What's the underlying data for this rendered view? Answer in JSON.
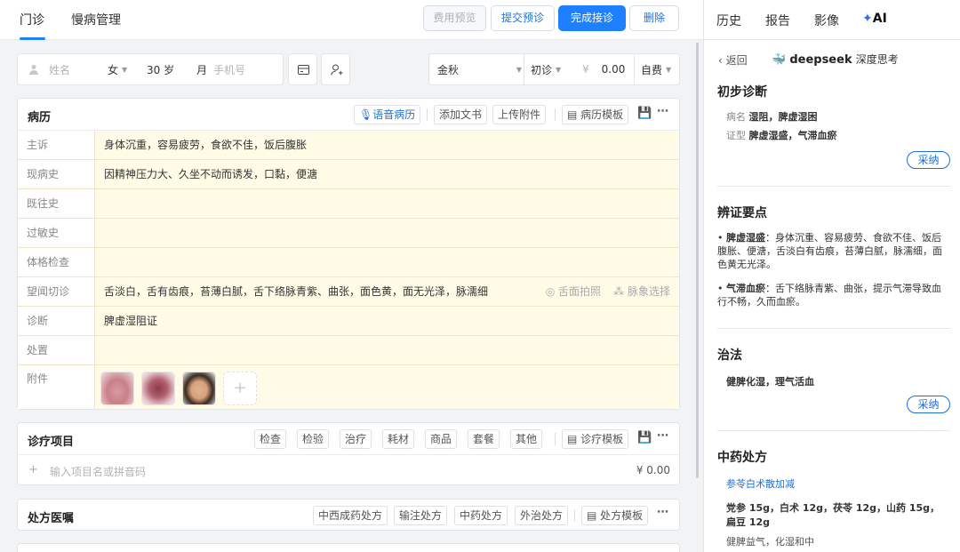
{
  "topbar": {
    "tabs": [
      "门诊",
      "慢病管理"
    ],
    "buttons": {
      "fee_preview": "费用预览",
      "submit_pre": "提交预诊",
      "complete": "完成接诊",
      "delete": "删除"
    }
  },
  "patient": {
    "name_placeholder": "姓名",
    "gender": "女",
    "age": "30 岁",
    "month": "月",
    "phone_placeholder": "手机号",
    "doctor": "金秋",
    "visit_type": "初诊",
    "currency": "¥",
    "fee": "0.00",
    "pay_type": "自费"
  },
  "record": {
    "title": "病历",
    "actions": {
      "voice": "语音病历",
      "add_text": "添加文书",
      "upload": "上传附件",
      "template": "病历模板"
    },
    "rows": [
      {
        "label": "主诉",
        "value": "身体沉重，容易疲劳，食欲不佳，饭后腹胀"
      },
      {
        "label": "现病史",
        "value": "因精神压力大、久坐不动而诱发，口黏，便溏"
      },
      {
        "label": "既往史",
        "value": ""
      },
      {
        "label": "过敏史",
        "value": ""
      },
      {
        "label": "体格检查",
        "value": ""
      },
      {
        "label": "望闻切诊",
        "value": "舌淡白，舌有齿痕，苔薄白腻，舌下络脉青紫、曲张，面色黄，面无光泽，脉濡细"
      },
      {
        "label": "诊断",
        "value": "脾虚湿阻证"
      },
      {
        "label": "处置",
        "value": ""
      },
      {
        "label": "附件",
        "value": ""
      }
    ],
    "tongue_photo": "舌面拍照",
    "pulse_select": "脉象选择"
  },
  "treatment": {
    "title": "诊疗项目",
    "chips": [
      "检查",
      "检验",
      "治疗",
      "耗材",
      "商品",
      "套餐",
      "其他"
    ],
    "template": "诊疗模板",
    "input_placeholder": "输入项目名或拼音码",
    "total": "¥ 0.00"
  },
  "prescription": {
    "title": "处方医嘱",
    "chips": [
      "中西成药处方",
      "输注处方",
      "中药处方",
      "外治处方"
    ],
    "template": "处方模板"
  },
  "right": {
    "tabs": [
      "历史",
      "报告",
      "影像",
      "AI"
    ],
    "back": "返回",
    "brand": "deepseek",
    "mode": "深度思考",
    "initial_dx": {
      "title": "初步诊断",
      "disease_label": "病名",
      "disease": "湿阻，脾虚湿困",
      "syndrome_label": "证型",
      "syndrome": "脾虚湿盛，气滞血瘀",
      "adopt": "采纳"
    },
    "key_points": {
      "title": "辨证要点",
      "items": [
        {
          "term": "脾虚湿盛",
          "text": "：身体沉重、容易疲劳、食欲不佳、饭后腹胀、便溏，舌淡白有齿痕，苔薄白腻，脉濡细，面色黄无光泽。"
        },
        {
          "term": "气滞血瘀",
          "text": "：舌下络脉青紫、曲张，提示气滞导致血行不畅，久而血瘀。"
        }
      ]
    },
    "therapy": {
      "title": "治法",
      "text": "健脾化湿，理气活血",
      "adopt": "采纳"
    },
    "herbal": {
      "title": "中药处方",
      "formula": "参苓白术散加减",
      "herbs": "党参 15g，白术 12g，茯苓 12g，山药 15g，扁豆 12g",
      "effect": "健脾益气，化湿和中"
    }
  }
}
